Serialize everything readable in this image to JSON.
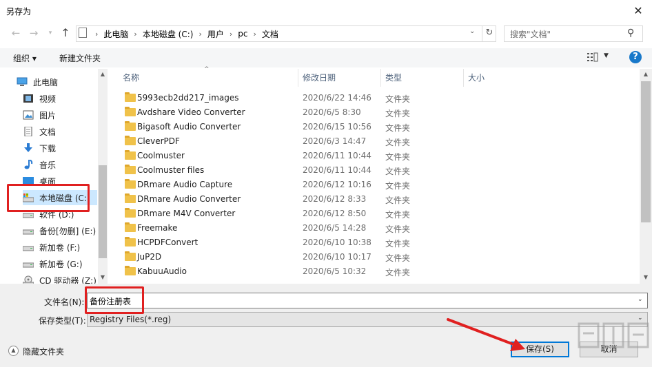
{
  "window": {
    "title": "另存为"
  },
  "nav": {
    "breadcrumbs": [
      "此电脑",
      "本地磁盘 (C:)",
      "用户",
      "pc",
      "文档"
    ],
    "search_placeholder": "搜索\"文档\""
  },
  "toolbar": {
    "organize": "组织 ▾",
    "new_folder": "新建文件夹"
  },
  "sidebar": {
    "items": [
      {
        "label": "此电脑",
        "icon": "pc-icon"
      },
      {
        "label": "视频",
        "icon": "video-folder-icon"
      },
      {
        "label": "图片",
        "icon": "pictures-folder-icon"
      },
      {
        "label": "文档",
        "icon": "documents-folder-icon"
      },
      {
        "label": "下载",
        "icon": "download-arrow-icon"
      },
      {
        "label": "音乐",
        "icon": "music-note-icon"
      },
      {
        "label": "桌面",
        "icon": "desktop-icon"
      },
      {
        "label": "本地磁盘 (C:)",
        "icon": "drive-icon"
      },
      {
        "label": "软件 (D:)",
        "icon": "drive-icon"
      },
      {
        "label": "备份[勿删] (E:)",
        "icon": "drive-icon"
      },
      {
        "label": "新加卷 (F:)",
        "icon": "drive-icon"
      },
      {
        "label": "新加卷 (G:)",
        "icon": "drive-icon"
      },
      {
        "label": "CD 驱动器 (Z:)",
        "icon": "cd-drive-icon"
      }
    ],
    "selected": "本地磁盘 (C:)"
  },
  "list": {
    "columns": [
      "名称",
      "修改日期",
      "类型",
      "大小"
    ],
    "rows": [
      {
        "name": "5993ecb2dd217_images",
        "date": "2020/6/22 14:46",
        "type": "文件夹"
      },
      {
        "name": "Avdshare Video Converter",
        "date": "2020/6/5 8:30",
        "type": "文件夹"
      },
      {
        "name": "Bigasoft Audio Converter",
        "date": "2020/6/15 10:56",
        "type": "文件夹"
      },
      {
        "name": "CleverPDF",
        "date": "2020/6/3 14:47",
        "type": "文件夹"
      },
      {
        "name": "Coolmuster",
        "date": "2020/6/11 10:44",
        "type": "文件夹"
      },
      {
        "name": "Coolmuster files",
        "date": "2020/6/11 10:44",
        "type": "文件夹"
      },
      {
        "name": "DRmare Audio Capture",
        "date": "2020/6/12 10:16",
        "type": "文件夹"
      },
      {
        "name": "DRmare Audio Converter",
        "date": "2020/6/12 8:33",
        "type": "文件夹"
      },
      {
        "name": "DRmare M4V Converter",
        "date": "2020/6/12 8:50",
        "type": "文件夹"
      },
      {
        "name": "Freemake",
        "date": "2020/6/5 14:28",
        "type": "文件夹"
      },
      {
        "name": "HCPDFConvert",
        "date": "2020/6/10 10:38",
        "type": "文件夹"
      },
      {
        "name": "JuP2D",
        "date": "2020/6/10 10:17",
        "type": "文件夹"
      },
      {
        "name": "KabuuAudio",
        "date": "2020/6/5 10:32",
        "type": "文件夹"
      }
    ]
  },
  "form": {
    "filename_label": "文件名(N):",
    "filename_value": "备份注册表",
    "filetype_label": "保存类型(T):",
    "filetype_value": "Registry Files(*.reg)",
    "hide_folders": "隐藏文件夹",
    "save_button": "保存(S)",
    "cancel_button": "取消"
  },
  "colors": {
    "accent": "#0078d7",
    "annotation_red": "#e02020",
    "folder": "#f0c24a"
  }
}
